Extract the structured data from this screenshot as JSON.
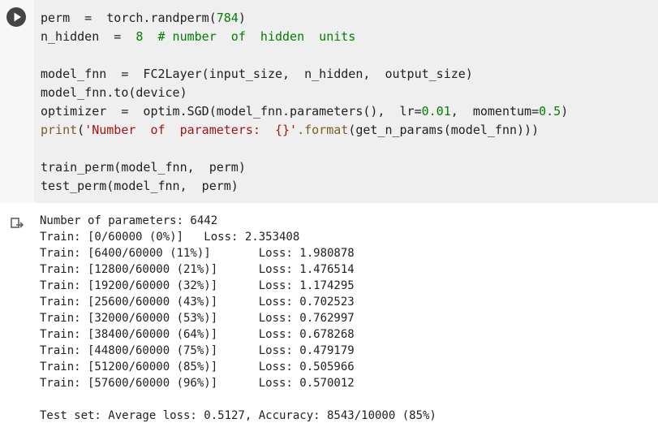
{
  "run_button": {
    "icon": "play-icon"
  },
  "output_button": {
    "icon": "output-clear-icon"
  },
  "code": [
    [
      {
        "t": "perm  =  torch.randperm(",
        "c": "default"
      },
      {
        "t": "784",
        "c": "num"
      },
      {
        "t": ")",
        "c": "default"
      }
    ],
    [
      {
        "t": "n_hidden  =  ",
        "c": "default"
      },
      {
        "t": "8",
        "c": "num"
      },
      {
        "t": "  # number  of  hidden  units",
        "c": "comment"
      }
    ],
    [],
    [
      {
        "t": "model_fnn  =  FC2Layer(input_size,  n_hidden,  output_size)",
        "c": "default"
      }
    ],
    [
      {
        "t": "model_fnn.to(device)",
        "c": "default"
      }
    ],
    [
      {
        "t": "optimizer  =  optim.SGD(model_fnn.parameters(),  lr=",
        "c": "default"
      },
      {
        "t": "0.01",
        "c": "num"
      },
      {
        "t": ",  momentum=",
        "c": "default"
      },
      {
        "t": "0.5",
        "c": "num"
      },
      {
        "t": ")",
        "c": "default"
      }
    ],
    [
      {
        "t": "print",
        "c": "builtin"
      },
      {
        "t": "(",
        "c": "default"
      },
      {
        "t": "'Number  of  parameters:  {}'",
        "c": "string"
      },
      {
        "t": ".format",
        "c": "builtin"
      },
      {
        "t": "(get_n_params(model_fnn)))",
        "c": "default"
      }
    ],
    [],
    [
      {
        "t": "train_perm(model_fnn,  perm)",
        "c": "default"
      }
    ],
    [
      {
        "t": "test_perm(model_fnn,  perm)",
        "c": "default"
      }
    ]
  ],
  "output": [
    "Number of parameters: 6442",
    "Train: [0/60000 (0%)]   Loss: 2.353408",
    "Train: [6400/60000 (11%)]       Loss: 1.980878",
    "Train: [12800/60000 (21%)]      Loss: 1.476514",
    "Train: [19200/60000 (32%)]      Loss: 1.174295",
    "Train: [25600/60000 (43%)]      Loss: 0.702523",
    "Train: [32000/60000 (53%)]      Loss: 0.762997",
    "Train: [38400/60000 (64%)]      Loss: 0.678268",
    "Train: [44800/60000 (75%)]      Loss: 0.479179",
    "Train: [51200/60000 (85%)]      Loss: 0.505966",
    "Train: [57600/60000 (96%)]      Loss: 0.570012",
    "",
    "Test set: Average loss: 0.5127, Accuracy: 8543/10000 (85%)"
  ]
}
